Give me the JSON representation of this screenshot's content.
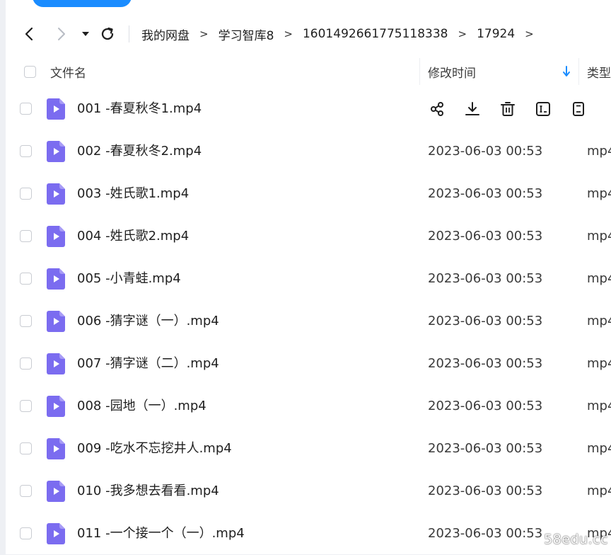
{
  "breadcrumb": [
    "我的网盘",
    "学习智库8",
    "1601492661775118338",
    "17924"
  ],
  "breadcrumb_separator": ">",
  "header": {
    "name": "文件名",
    "time": "修改时间",
    "type": "类型"
  },
  "colors": {
    "accent": "#1a8cff",
    "file_icon": "#7b6cf0"
  },
  "files": [
    {
      "name": "001 -春夏秋冬1.mp4",
      "time": "",
      "type": ""
    },
    {
      "name": "002 -春夏秋冬2.mp4",
      "time": "2023-06-03 00:53",
      "type": "mp4"
    },
    {
      "name": "003 -姓氏歌1.mp4",
      "time": "2023-06-03 00:53",
      "type": "mp4"
    },
    {
      "name": "004 -姓氏歌2.mp4",
      "time": "2023-06-03 00:53",
      "type": "mp4"
    },
    {
      "name": "005 -小青蛙.mp4",
      "time": "2023-06-03 00:53",
      "type": "mp4"
    },
    {
      "name": "006 -猜字谜（一）.mp4",
      "time": "2023-06-03 00:53",
      "type": "mp4"
    },
    {
      "name": "007 -猜字谜（二）.mp4",
      "time": "2023-06-03 00:53",
      "type": "mp4"
    },
    {
      "name": "008 -园地（一）.mp4",
      "time": "2023-06-03 00:53",
      "type": "mp4"
    },
    {
      "name": "009 -吃水不忘挖井人.mp4",
      "time": "2023-06-03 00:53",
      "type": "mp4"
    },
    {
      "name": "010 -我多想去看看.mp4",
      "time": "2023-06-03 00:53",
      "type": "mp4"
    },
    {
      "name": "011 -一个接一个（一）.mp4",
      "time": "2023-06-03 00:53",
      "type": "mp4"
    }
  ],
  "watermark": "58edu.cc"
}
